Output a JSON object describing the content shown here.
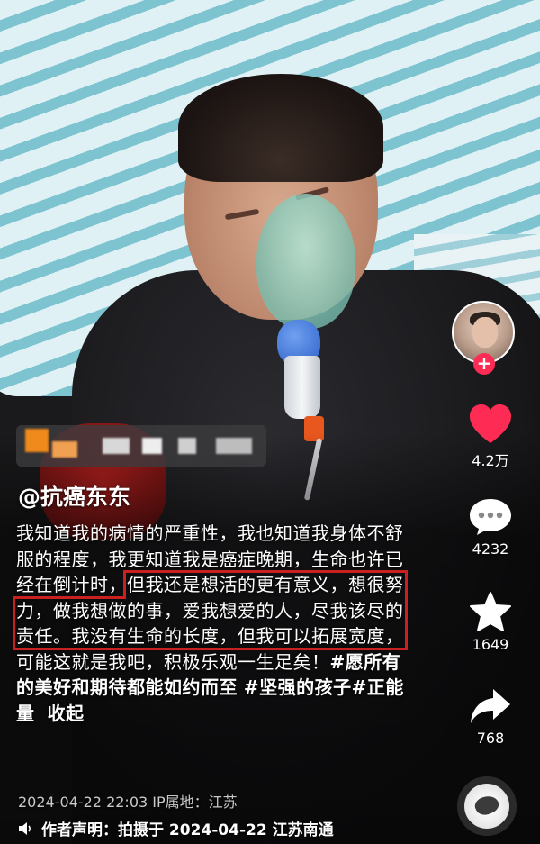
{
  "post": {
    "username": "@抗癌东东",
    "caption": {
      "part1": "我知道我的病情的严重性，我也知道我身体不舒服的程度，我更知道我是癌症晚期，生命也许已经在倒计时，",
      "highlighted": "但我还是想活的更有意义，想很努力，做我想做的事，爱我想爱的人，尽我该尽的责任。我没有生命的长度，但我可以拓展宽度，",
      "part2": "可能这就是我吧，积极乐观一生足矣！",
      "tag1": "#愿所有的美好和期待都能如约而至",
      "tag2": "#坚强的孩子",
      "tag3": "#正能量",
      "collapse": "收起"
    },
    "timestamp": "2024-04-22 22:03  IP属地：江苏",
    "statement": "作者声明：拍摄于 2024-04-22 江苏南通",
    "highlight_color": "#c8211f"
  },
  "actions": {
    "follow_label": "+",
    "likes": "4.2万",
    "comments": "4232",
    "favorites": "1649",
    "shares": "768",
    "like_color": "#fe2c55",
    "icons": [
      "heart-icon",
      "comment-icon",
      "star-icon",
      "share-icon",
      "speaker-icon"
    ]
  }
}
